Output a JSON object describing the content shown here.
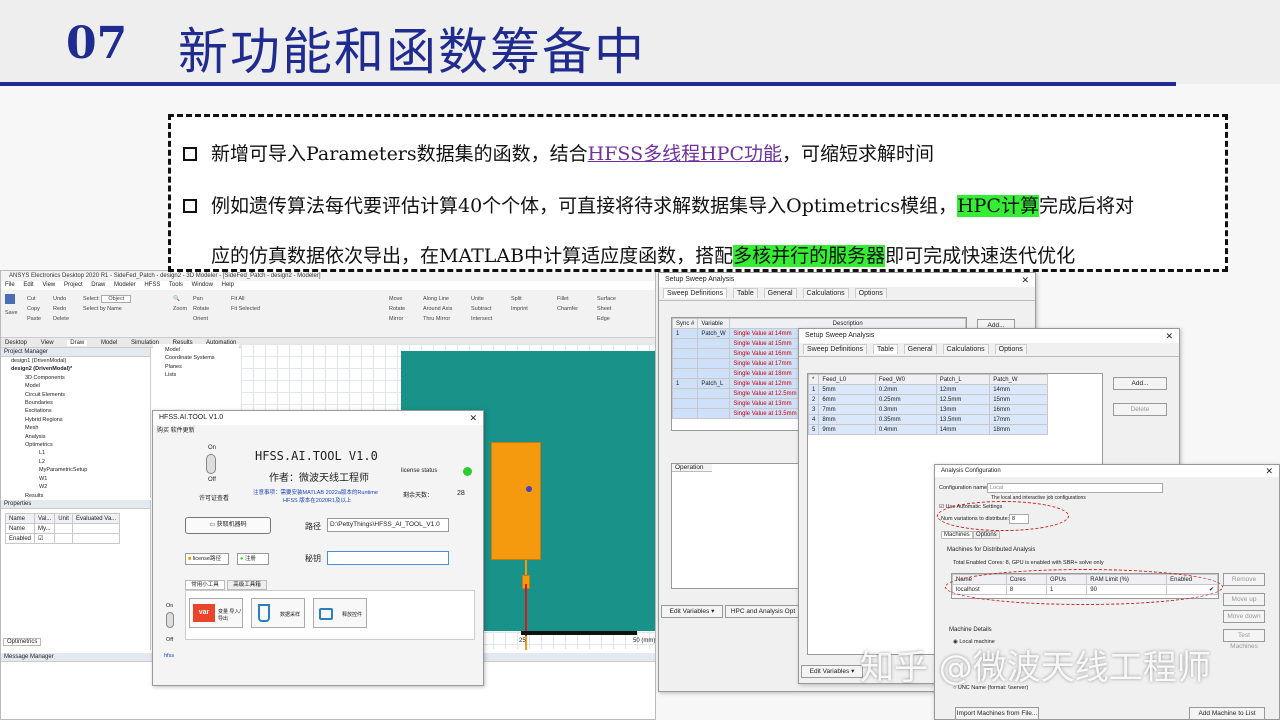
{
  "slide": {
    "number": "07",
    "title": "新功能和函数筹备中"
  },
  "bullets": {
    "b1_pre": "新增可导入Parameters数据集的函数，结合",
    "b1_link": "HFSS多线程HPC功能",
    "b1_post": "，可缩短求解时间",
    "b2_pre": "例如遗传算法每代要评估计算40个个体，可直接将待求解数据集导入Optimetrics模组，",
    "b2_hl1": "HPC计算",
    "b2_post1": "完成后将对",
    "b2_line2_pre": "应的仿真数据依次导出，在MATLAB中计算适应度函数，搭配",
    "b2_hl2": "多核并行的服务器",
    "b2_post2": "即可完成快速迭代优化"
  },
  "ansys": {
    "window_title": "ANSYS Electronics Desktop 2020 R1 - SideFed_Patch - design2 - 3D Modeler - [SideFed_Patch - design2 - Modeler]",
    "menu": [
      "File",
      "Edit",
      "View",
      "Project",
      "Draw",
      "Modeler",
      "HFSS",
      "Tools",
      "Window",
      "Help"
    ],
    "ribbon": {
      "save": "Save",
      "cut": "Cut",
      "copy": "Copy",
      "paste": "Paste",
      "undo": "Undo",
      "redo": "Redo",
      "delete": "Delete",
      "select": "Select:",
      "select_value": "Object",
      "select_by_name": "Select by Name",
      "zoom": "Zoom",
      "pan": "Pan",
      "rotate": "Rotate",
      "orient": "Orient",
      "fit_all": "Fit All",
      "fit_selected": "Fit Selected",
      "move": "Move",
      "rotate2": "Rotate",
      "mirror": "Mirror",
      "along_line": "Along Line",
      "around_axis": "Around Axis",
      "thru_mirror": "Thru Mirror",
      "unite": "Unite",
      "subtract": "Subtract",
      "intersect": "Intersect",
      "split": "Split",
      "imprint": "Imprint",
      "fillet": "Fillet",
      "chamfer": "Chamfer",
      "surface": "Surface",
      "sheet": "Sheet",
      "edge": "Edge"
    },
    "tabs": [
      "Desktop",
      "View",
      "Draw",
      "Model",
      "Simulation",
      "Results",
      "Automation"
    ],
    "project_manager": "Project Manager",
    "tree": [
      "design1 (DrivenModal)",
      "design2 (DrivenModal)*",
      "3D Components",
      "Model",
      "Circuit Elements",
      "Boundaries",
      "Excitations",
      "Hybrid Regions",
      "Mesh",
      "Analysis",
      "Optimetrics",
      "L1",
      "L2",
      "MyParametricSetup",
      "W1",
      "W2",
      "Results"
    ],
    "model_tree": [
      "Model",
      "Coordinate Systems",
      "Planes",
      "Lists"
    ],
    "properties": "Properties",
    "props_headers": [
      "Name",
      "Val...",
      "Unit",
      "Evaluated Va..."
    ],
    "props_rows": [
      [
        "Name",
        "My...",
        "",
        ""
      ],
      [
        "Enabled",
        "",
        "",
        ""
      ]
    ],
    "optimetrics_tab": "Optimetrics",
    "message_manager": "Message Manager",
    "ruler": [
      "25",
      "50 (mm)"
    ]
  },
  "hfss_tool": {
    "window_title": "HFSS.AI.TOOL V1.0",
    "menu": "购买 软件更新",
    "title": "HFSS.AI.TOOL V1.0",
    "author": "作者：微波天线工程师",
    "license_status": "license status",
    "on": "On",
    "off": "Off",
    "license_check": "许可证查看",
    "notice_line1": "注意事项：需要安装MATLAB 2022a版本的Runtime",
    "notice_line2": "HFSS 版本在2020R1及以上",
    "remaining_days_label": "剩余天数：",
    "remaining_days": "28",
    "get_code": "获取机器码",
    "path_label": "路径",
    "path_value": "D:\\PettyThings\\HFSS_AI_TOOL_V1.0",
    "license_path": "license路径",
    "register": "注册",
    "key_label": "秘钥",
    "tab_common": "常用小工具",
    "tab_advanced": "高级工具箱",
    "tool1": "变量 导入/导出",
    "tool2": "数据采样",
    "tool3": "释放控件",
    "on2": "On",
    "off2": "Off",
    "hfss": "hfss"
  },
  "sweep1": {
    "title": "Setup Sweep Analysis",
    "tabs": [
      "Sweep Definitions",
      "Table",
      "General",
      "Calculations",
      "Options"
    ],
    "headers": [
      "Sync #",
      "Variable",
      "Description"
    ],
    "rows": [
      [
        "1",
        "Patch_W",
        "Single Value at 14mm"
      ],
      [
        "",
        "",
        "Single Value at 15mm"
      ],
      [
        "",
        "",
        "Single Value at 16mm"
      ],
      [
        "",
        "",
        "Single Value at 17mm"
      ],
      [
        "",
        "",
        "Single Value at 18mm"
      ],
      [
        "1",
        "Patch_L",
        "Single Value at 12mm"
      ],
      [
        "",
        "",
        "Single Value at 12.5mm"
      ],
      [
        "",
        "",
        "Single Value at 13mm"
      ],
      [
        "",
        "",
        "Single Value at 13.5mm"
      ]
    ],
    "add": "Add...",
    "operation": "Operation",
    "edit_variables": "Edit Variables",
    "hpc": "HPC and Analysis Opt"
  },
  "sweep2": {
    "title": "Setup Sweep Analysis",
    "tabs": [
      "Sweep Definitions",
      "Table",
      "General",
      "Calculations",
      "Options"
    ],
    "headers": [
      "*",
      "Feed_L0",
      "Feed_W0",
      "Patch_L",
      "Patch_W"
    ],
    "rows": [
      [
        "1",
        "5mm",
        "0.2mm",
        "12mm",
        "14mm"
      ],
      [
        "2",
        "6mm",
        "0.25mm",
        "12.5mm",
        "15mm"
      ],
      [
        "3",
        "7mm",
        "0.3mm",
        "13mm",
        "16mm"
      ],
      [
        "4",
        "8mm",
        "0.35mm",
        "13.5mm",
        "17mm"
      ],
      [
        "5",
        "9mm",
        "0.4mm",
        "14mm",
        "18mm"
      ]
    ],
    "add": "Add...",
    "delete": "Delete",
    "edit_variables": "Edit Variables"
  },
  "analysis_cfg": {
    "title": "Analysis Configuration",
    "config_name_label": "Configuration name:",
    "config_name_value": "Local",
    "desc": "The local and interactive job configurations",
    "use_auto": "Use Automatic Settings",
    "num_var_label": "Num variations to distribute:",
    "num_var_value": "8",
    "tabs": [
      "Machines",
      "Options"
    ],
    "machines_header": "Machines for Distributed Analysis",
    "total": "Total Enabled Cores: 8, GPU is enabled with SBR+ solve only",
    "headers": [
      "Name",
      "Cores",
      "GPUs",
      "RAM Limit (%)",
      "Enabled"
    ],
    "row": [
      "localhost",
      "8",
      "1",
      "90",
      "✔"
    ],
    "remove": "Remove",
    "move_up": "Move up",
    "move_down": "Move down",
    "machine_details": "Machine Details",
    "local_machine": "Local machine",
    "unc": "UNC Name (format: \\\\server)",
    "test_machines": "Test Machines",
    "import_machines": "Import Machines from File...",
    "add_machine": "Add Machine to List"
  },
  "watermark": "知乎 @微波天线工程师",
  "colors": {
    "title_blue": "#1f2b8f",
    "highlight_green": "#33ee33",
    "link_purple": "#7030a0",
    "substrate_teal": "#199289",
    "patch_orange": "#f5990f",
    "selection_blue": "#cfe0fa"
  }
}
